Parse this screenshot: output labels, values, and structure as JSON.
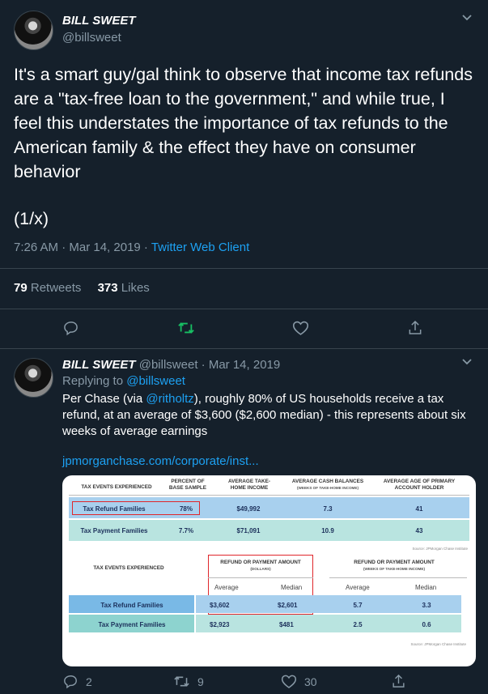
{
  "tweet1": {
    "name": "BILL SWEET",
    "handle": "@billsweet",
    "text": "It's a smart guy/gal think to observe that income tax refunds are a \"tax-free loan to the government,\" and while true, I feel this understates the importance of tax refunds to the American family & the effect they have on consumer behavior",
    "thread_marker": "(1/x)",
    "time": "7:26 AM · Mar 14, 2019 · ",
    "client": "Twitter Web Client",
    "retweets_count": "79",
    "retweets_label": "Retweets",
    "likes_count": "373",
    "likes_label": "Likes"
  },
  "tweet2": {
    "name": "BILL SWEET",
    "handle": "@billsweet",
    "date": "· Mar 14, 2019",
    "replying_prefix": "Replying to ",
    "replying_handle": "@billsweet",
    "text_before": "Per Chase (via ",
    "mention": "@ritholtz",
    "text_after": "), roughly 80% of US households receive a tax refund, at an average of $3,600 ($2,600 median) - this represents about six weeks of average earnings",
    "url": "jpmorganchase.com/corporate/inst...",
    "reply_count": "2",
    "retweet_count": "9",
    "like_count": "30"
  },
  "image": {
    "t1": {
      "headers": [
        "TAX EVENTS EXPERIENCED",
        "PERCENT OF BASE SAMPLE",
        "AVERAGE TAKE-HOME INCOME",
        "AVERAGE CASH BALANCES",
        "AVERAGE AGE OF PRIMARY ACCOUNT HOLDER"
      ],
      "cash_sub": "(WEEKS OF TAKE-HOME INCOME)",
      "rows": [
        [
          "Tax Refund Families",
          "78%",
          "$49,992",
          "7.3",
          "41"
        ],
        [
          "Tax Payment Families",
          "7.7%",
          "$71,091",
          "10.9",
          "43"
        ]
      ],
      "source": "Source: JPMorgan Chase Institute"
    },
    "t2": {
      "header_events": "TAX EVENTS EXPERIENCED",
      "header_dollars": "REFUND OR PAYMENT AMOUNT",
      "dollars_sub": "(DOLLARS)",
      "header_weeks": "REFUND OR PAYMENT AMOUNT",
      "weeks_sub": "(WEEKS OF TAKE-HOME INCOME)",
      "sub_headers": [
        "Average",
        "Median",
        "Average",
        "Median"
      ],
      "rows": [
        [
          "Tax Refund Families",
          "$3,602",
          "$2,601",
          "5.7",
          "3.3"
        ],
        [
          "Tax Payment Families",
          "$2,923",
          "$481",
          "2.5",
          "0.6"
        ]
      ],
      "source": "Source: JPMorgan Chase Institute"
    }
  },
  "colors": {
    "background": "#15202b",
    "accent": "#1da1f2",
    "retweet_green": "#17bf63",
    "muted": "#8899a6",
    "divider": "#38444d",
    "highlight_red": "#e0262b"
  }
}
